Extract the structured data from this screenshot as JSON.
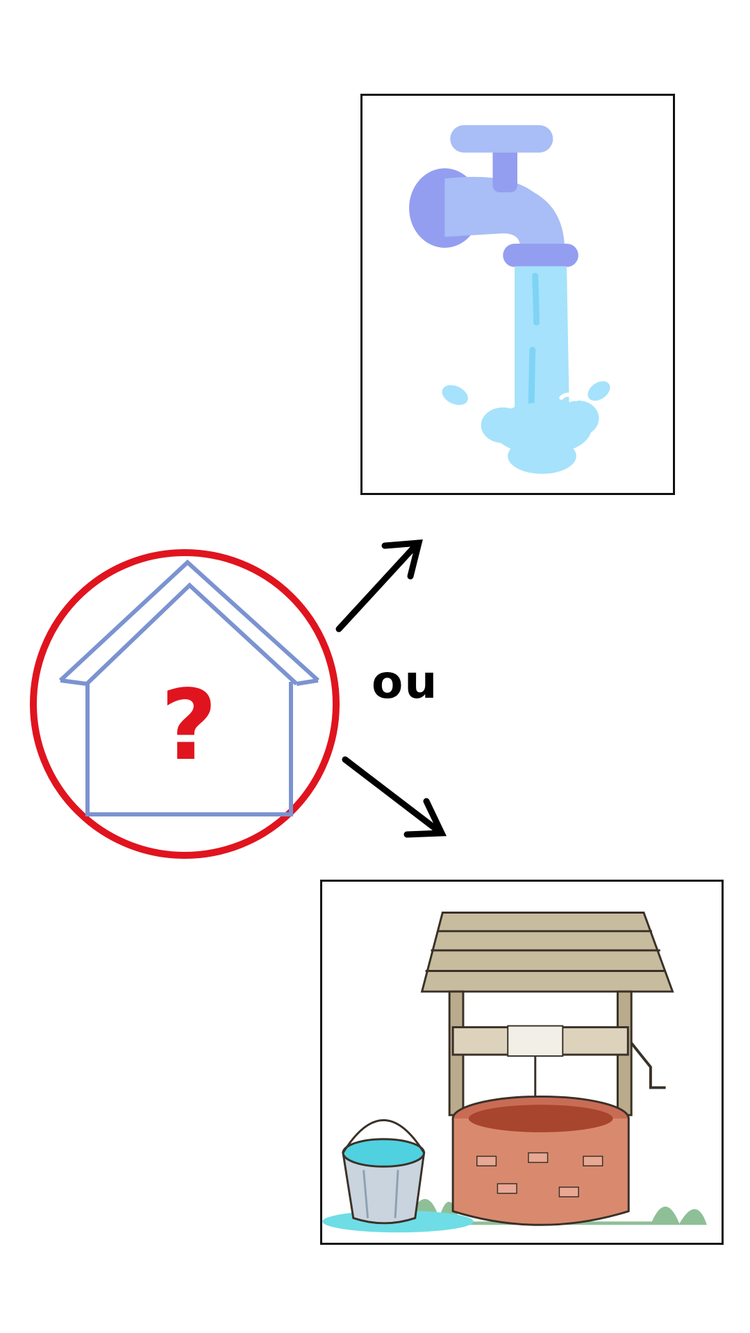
{
  "center": {
    "label": "ou",
    "question_mark": "?",
    "circle_color": "#e0141e",
    "house_color": "#7b93d1",
    "question_color": "#e0141e"
  },
  "options": [
    {
      "name": "faucet-illustration",
      "icon": "faucet-icon",
      "colors": {
        "tap": "#a9bdf6",
        "tap_dark": "#949ef0",
        "water": "#a6e2fb"
      }
    },
    {
      "name": "well-illustration",
      "icon": "water-well-icon",
      "colors": {
        "roof": "#b8ab8f",
        "brick": "#c96c55",
        "bucket_water": "#4fd1e0"
      }
    }
  ],
  "arrows": {
    "color": "#000000"
  }
}
